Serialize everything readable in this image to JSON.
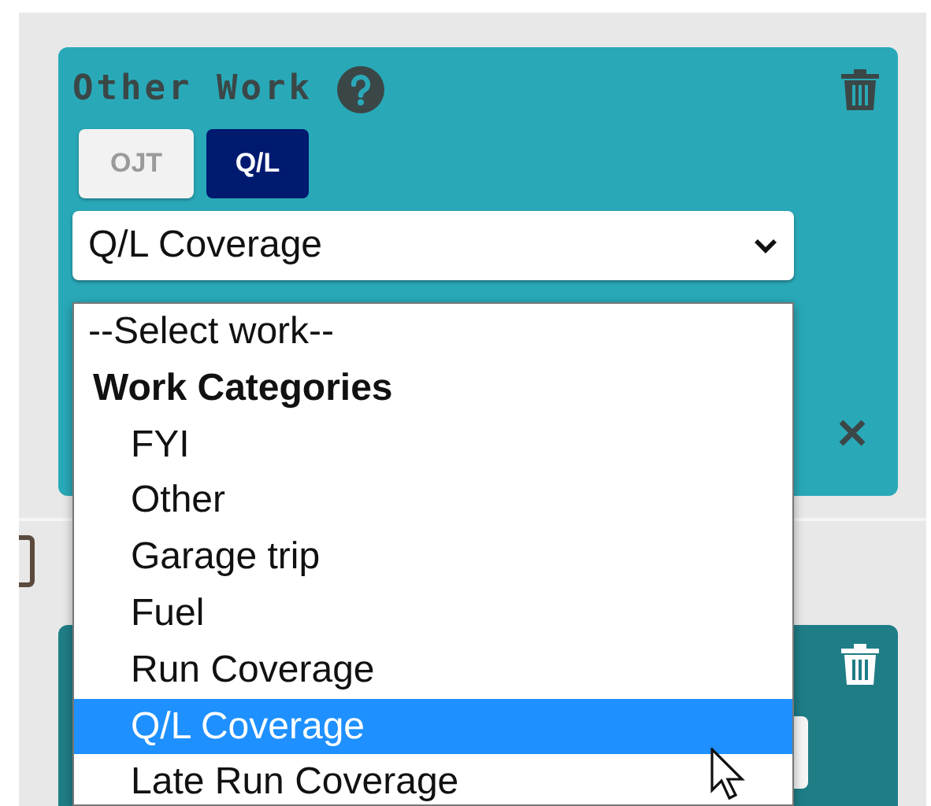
{
  "card": {
    "title": "Other Work",
    "toggles": [
      {
        "label": "OJT",
        "selected": false
      },
      {
        "label": "Q/L",
        "selected": true
      }
    ],
    "select": {
      "value": "Q/L Coverage"
    },
    "options": [
      {
        "kind": "option",
        "label": "--Select work--",
        "selected": false
      },
      {
        "kind": "group",
        "label": "Work Categories",
        "children": [
          {
            "label": "FYI",
            "selected": false
          },
          {
            "label": "Other",
            "selected": false
          },
          {
            "label": "Garage trip",
            "selected": false
          },
          {
            "label": "Fuel",
            "selected": false
          },
          {
            "label": "Run Coverage",
            "selected": false
          },
          {
            "label": "Q/L Coverage",
            "selected": true
          },
          {
            "label": "Late Run Coverage",
            "selected": false
          }
        ]
      }
    ]
  }
}
